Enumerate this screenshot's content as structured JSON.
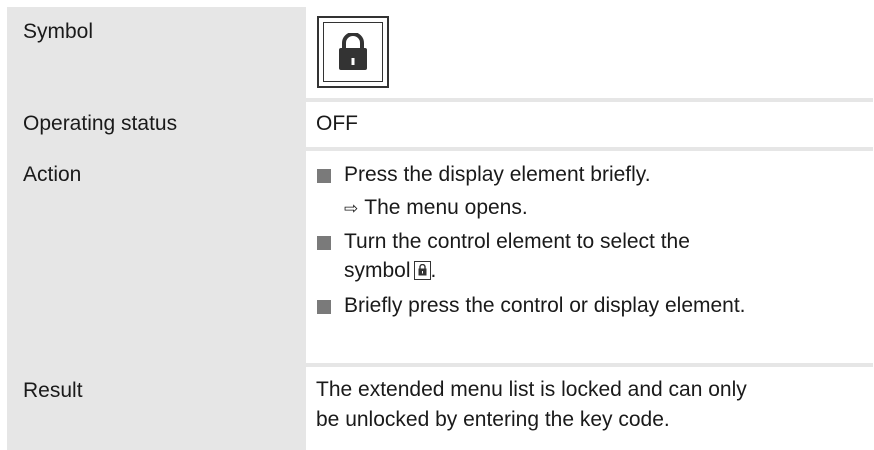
{
  "rows": {
    "symbol": {
      "label": "Symbol",
      "icon": "lock-icon"
    },
    "operating_status": {
      "label": "Operating status",
      "value": "OFF"
    },
    "action": {
      "label": "Action",
      "step1": "Press the display element briefly.",
      "step1_result": "The menu opens.",
      "step2_line1": "Turn the control element to select the",
      "step2_line2": "symbol",
      "step2_end": ".",
      "step3": "Briefly press the control or display element."
    },
    "result": {
      "label": "Result",
      "line1": "The extended menu list is locked and can only",
      "line2": "be unlocked by entering the key code."
    }
  }
}
